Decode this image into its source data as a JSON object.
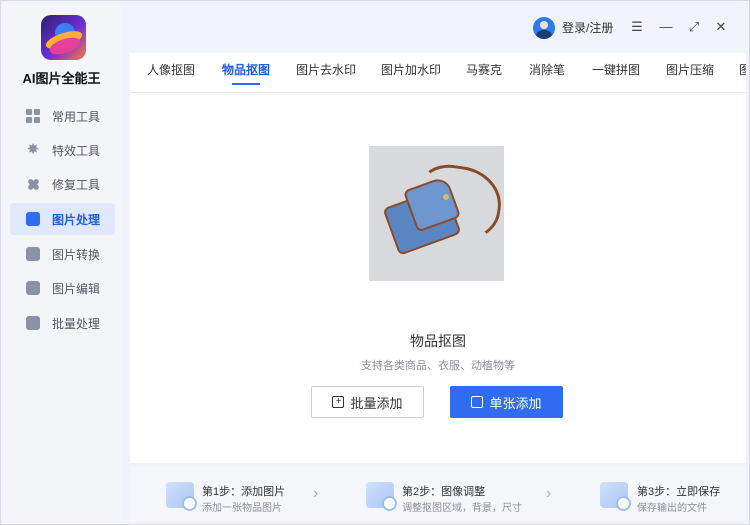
{
  "app": {
    "name": "AI图片全能王"
  },
  "sidebar": {
    "items": [
      {
        "label": "常用工具",
        "icon": "grid-icon"
      },
      {
        "label": "特效工具",
        "icon": "sparkle-icon"
      },
      {
        "label": "修复工具",
        "icon": "bandage-icon"
      },
      {
        "label": "图片处理",
        "icon": "image-process-icon",
        "active": true
      },
      {
        "label": "图片转换",
        "icon": "convert-icon"
      },
      {
        "label": "图片编辑",
        "icon": "edit-icon"
      },
      {
        "label": "批量处理",
        "icon": "batch-upload-icon"
      }
    ]
  },
  "header": {
    "login": "登录/注册",
    "controls": {
      "menu": "☰",
      "minimize": "—",
      "maximize": "⤢",
      "close": "✕"
    }
  },
  "tabs": [
    {
      "label": "人像抠图"
    },
    {
      "label": "物品抠图",
      "active": true
    },
    {
      "label": "图片去水印"
    },
    {
      "label": "图片加水印"
    },
    {
      "label": "马赛克"
    },
    {
      "label": "消除笔"
    },
    {
      "label": "一键拼图"
    },
    {
      "label": "图片压缩"
    },
    {
      "label": "图"
    }
  ],
  "main": {
    "title": "物品抠图",
    "subtitle": "支持各类商品、衣服、动植物等",
    "batch_button": "批量添加",
    "single_button": "单张添加"
  },
  "steps": [
    {
      "title": "第1步：添加图片",
      "desc": "添加一张物品图片"
    },
    {
      "title": "第2步：图像调整",
      "desc": "调整抠图区域，背景，尺寸"
    },
    {
      "title": "第3步：立即保存",
      "desc": "保存输出的文件"
    }
  ],
  "colors": {
    "accent": "#2f6cf2",
    "active_bg": "#e0e9fb"
  }
}
